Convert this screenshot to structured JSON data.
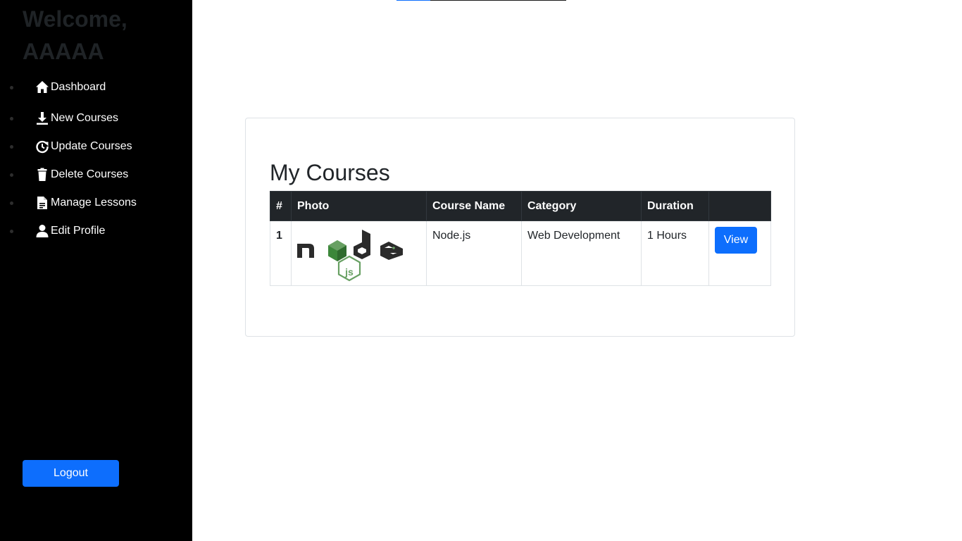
{
  "sidebar": {
    "welcome": "Welcome, AAAAA",
    "items": [
      {
        "label": "Dashboard",
        "icon": "home-icon"
      },
      {
        "label": "New Courses",
        "icon": "download-icon"
      },
      {
        "label": "Update Courses",
        "icon": "refresh-icon"
      },
      {
        "label": "Delete Courses",
        "icon": "trash-icon"
      },
      {
        "label": "Manage Lessons",
        "icon": "document-icon"
      },
      {
        "label": "Edit Profile",
        "icon": "user-icon"
      }
    ],
    "logout_label": "Logout"
  },
  "colors": {
    "sidebar_bg": "#000000",
    "accent": "#0d6efd",
    "table_header_bg": "#212529"
  },
  "main": {
    "title": "My Courses",
    "table": {
      "columns": [
        "#",
        "Photo",
        "Course Name",
        "Category",
        "Duration",
        ""
      ],
      "rows": [
        {
          "num": "1",
          "photo": {
            "logo_text": "node",
            "badge_text": "JS"
          },
          "name": "Node.js",
          "category": "Web Development",
          "duration": "1 Hours",
          "action_label": "View"
        }
      ]
    }
  }
}
